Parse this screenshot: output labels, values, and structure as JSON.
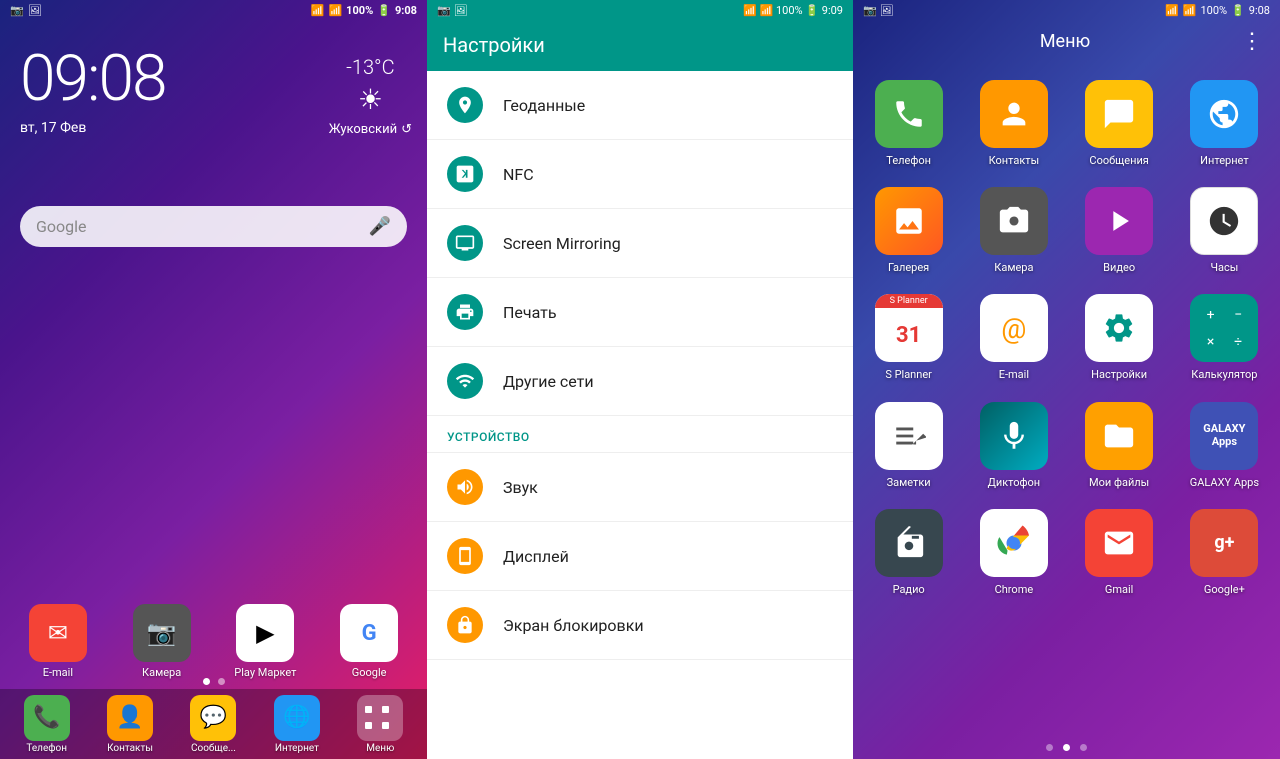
{
  "panel1": {
    "status_bar": {
      "left": "📶 🔋",
      "time": "9:08",
      "battery": "100%"
    },
    "clock": {
      "time": "09:08",
      "date": "вт, 17 Фев"
    },
    "weather": {
      "temp": "-13°C",
      "city": "Жуковский"
    },
    "search": {
      "placeholder": "Google",
      "mic_label": "mic"
    },
    "apps": [
      {
        "label": "E-mail",
        "icon": "✉",
        "color": "ic-red"
      },
      {
        "label": "Камера",
        "icon": "📷",
        "color": "ic-grey"
      },
      {
        "label": "Play Маркет",
        "icon": "▶",
        "color": "ic-white-border"
      },
      {
        "label": "Google",
        "icon": "G",
        "color": "ic-white-border"
      }
    ],
    "dock": [
      {
        "label": "Телефон",
        "icon": "📞",
        "color": "ic-green"
      },
      {
        "label": "Контакты",
        "icon": "👤",
        "color": "ic-orange"
      },
      {
        "label": "Сообще...",
        "icon": "💬",
        "color": "ic-yellow"
      },
      {
        "label": "Интернет",
        "icon": "🌐",
        "color": "ic-blue"
      },
      {
        "label": "Меню",
        "icon": "⋮⋮",
        "color": "ic-grey"
      }
    ]
  },
  "panel2": {
    "status_bar": {
      "time": "9:09",
      "battery": "100%"
    },
    "header": {
      "title": "Настройки"
    },
    "items": [
      {
        "label": "Геоданные",
        "icon": "📍",
        "color": "ic-teal",
        "type": "item"
      },
      {
        "label": "NFC",
        "icon": "📲",
        "color": "ic-teal",
        "type": "item"
      },
      {
        "label": "Screen Mirroring",
        "icon": "📺",
        "color": "ic-teal",
        "type": "item"
      },
      {
        "label": "Печать",
        "icon": "🖨",
        "color": "ic-teal",
        "type": "item"
      },
      {
        "label": "Другие сети",
        "icon": "📡",
        "color": "ic-teal",
        "type": "item"
      },
      {
        "label": "УСТРОЙСТВО",
        "type": "section"
      },
      {
        "label": "Звук",
        "icon": "🔊",
        "color": "ic-orange",
        "type": "item"
      },
      {
        "label": "Дисплей",
        "icon": "📱",
        "color": "ic-orange",
        "type": "item"
      },
      {
        "label": "Экран блокировки",
        "icon": "🔒",
        "color": "ic-orange",
        "type": "item"
      }
    ]
  },
  "panel3": {
    "status_bar": {
      "time": "9:08",
      "battery": "100%"
    },
    "header": {
      "title": "Меню",
      "menu_icon": "⋮"
    },
    "apps": [
      {
        "label": "Телефон",
        "icon": "📞",
        "color": "ic-green"
      },
      {
        "label": "Контакты",
        "icon": "👤",
        "color": "ic-orange"
      },
      {
        "label": "Сообщения",
        "icon": "✉",
        "color": "ic-yellow"
      },
      {
        "label": "Интернет",
        "icon": "🌐",
        "color": "ic-blue"
      },
      {
        "label": "Галерея",
        "icon": "🖼",
        "color": "ic-yellow"
      },
      {
        "label": "Камера",
        "icon": "📷",
        "color": "ic-grey"
      },
      {
        "label": "Видео",
        "icon": "▶",
        "color": "ic-purple"
      },
      {
        "label": "Часы",
        "icon": "🕐",
        "color": "ic-white-border"
      },
      {
        "label": "S Planner",
        "icon": "31",
        "color": "ic-white-border"
      },
      {
        "label": "E-mail",
        "icon": "@",
        "color": "ic-white-border"
      },
      {
        "label": "Настройки",
        "icon": "⚙",
        "color": "ic-white-border"
      },
      {
        "label": "Калькулятор",
        "icon": "⊞",
        "color": "ic-teal"
      },
      {
        "label": "Заметки",
        "icon": "📝",
        "color": "ic-white-border"
      },
      {
        "label": "Диктофон",
        "icon": "🎙",
        "color": "ic-cyan"
      },
      {
        "label": "Мои файлы",
        "icon": "📁",
        "color": "ic-yellow"
      },
      {
        "label": "GALAXY Apps",
        "icon": "G",
        "color": "ic-indigo"
      },
      {
        "label": "Радио",
        "icon": "📻",
        "color": "ic-dark"
      },
      {
        "label": "Chrome",
        "icon": "⬤",
        "color": "ic-white-border"
      },
      {
        "label": "Gmail",
        "icon": "M",
        "color": "ic-red"
      },
      {
        "label": "Google+",
        "icon": "g+",
        "color": "ic-red"
      }
    ],
    "dots": [
      false,
      true,
      false
    ]
  }
}
